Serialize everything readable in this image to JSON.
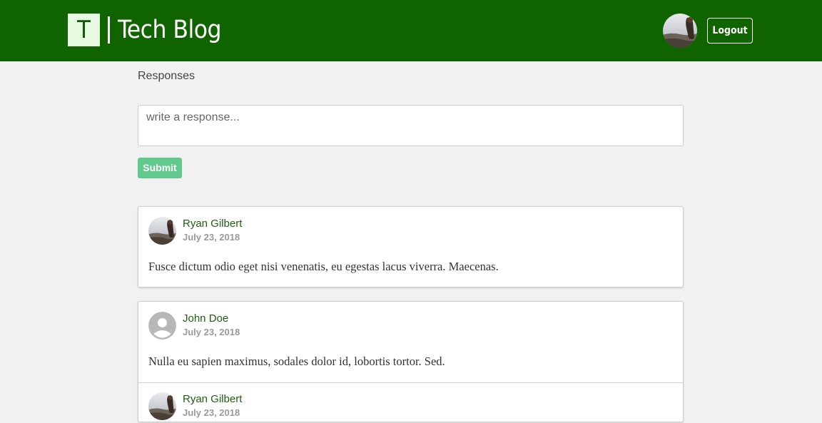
{
  "header": {
    "logo_letter": "T",
    "title": "Tech Blog",
    "logout_label": "Logout",
    "background_color": "#0f6400",
    "avatar_icon": "user-photo-avatar"
  },
  "responses": {
    "title": "Responses",
    "input": {
      "placeholder": "write a response...",
      "value": ""
    },
    "submit_label": "Submit",
    "submit_color": "#60c98b"
  },
  "comments": [
    {
      "author": "Ryan Gilbert",
      "date": "July 23, 2018",
      "text": "Fusce dictum odio eget nisi venenatis, eu egestas lacus viverra. Maecenas.",
      "avatar": "photo"
    },
    {
      "author": "John Doe",
      "date": "July 23, 2018",
      "text": "Nulla eu sapien maximus, sodales dolor id, lobortis tortor. Sed.",
      "avatar": "default-user-icon"
    },
    {
      "author": "Ryan Gilbert",
      "date": "July 23, 2018",
      "avatar": "photo"
    }
  ],
  "colors": {
    "author_link": "#1f5d12",
    "date_gray": "#9a9a9a",
    "page_background": "#f1f1f1"
  }
}
